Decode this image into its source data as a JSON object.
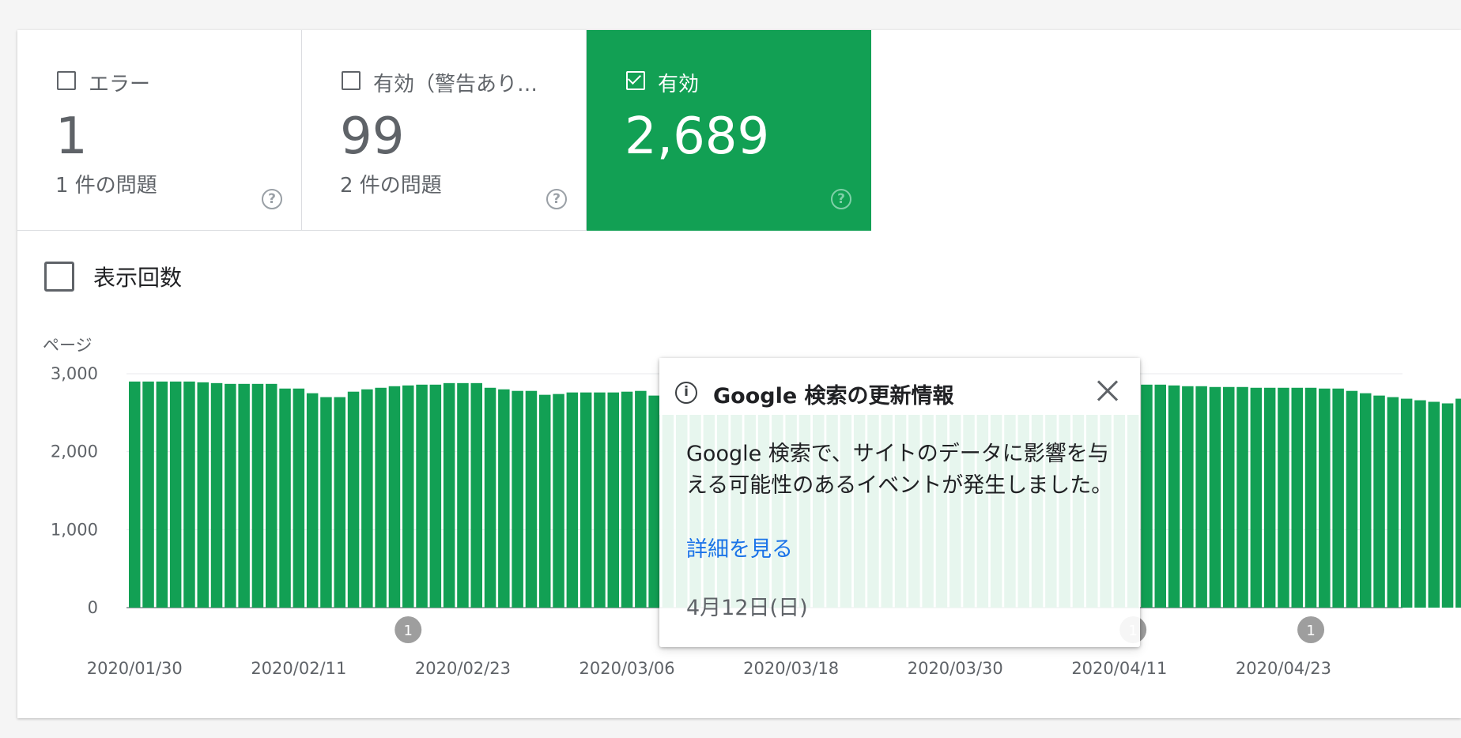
{
  "tiles": [
    {
      "label": "エラー",
      "value": "1",
      "sub": "1 件の問題",
      "checked": false,
      "help": "?"
    },
    {
      "label": "有効（警告あり…",
      "value": "99",
      "sub": "2 件の問題",
      "checked": false,
      "help": "?"
    },
    {
      "label": "有効",
      "value": "2,689",
      "sub": "",
      "checked": true,
      "help": "?"
    }
  ],
  "impressions_toggle": {
    "label": "表示回数"
  },
  "colors": {
    "accent": "#12a054",
    "grid": "#e8eaed",
    "axis_text": "#5f6368",
    "marker": "#9e9e9e",
    "highlight": "#e6f4ec"
  },
  "chart_data": {
    "type": "bar",
    "ylabel": "ページ",
    "ylim": [
      0,
      3000
    ],
    "yticks": [
      {
        "v": 0,
        "label": "0"
      },
      {
        "v": 1000,
        "label": "1,000"
      },
      {
        "v": 2000,
        "label": "2,000"
      },
      {
        "v": 3000,
        "label": "3,000"
      }
    ],
    "xtick_labels": [
      {
        "x": "2020-01-30",
        "label": "2020/01/30"
      },
      {
        "x": "2020-02-11",
        "label": "2020/02/11"
      },
      {
        "x": "2020-02-23",
        "label": "2020/02/23"
      },
      {
        "x": "2020-03-06",
        "label": "2020/03/06"
      },
      {
        "x": "2020-03-18",
        "label": "2020/03/18"
      },
      {
        "x": "2020-03-30",
        "label": "2020/03/30"
      },
      {
        "x": "2020-04-11",
        "label": "2020/04/11"
      },
      {
        "x": "2020-04-23",
        "label": "2020/04/23"
      }
    ],
    "series": [
      {
        "values": [
          2900,
          2900,
          2900,
          2900,
          2900,
          2890,
          2880,
          2870,
          2870,
          2870,
          2870,
          2810,
          2810,
          2750,
          2700,
          2700,
          2770,
          2800,
          2820,
          2840,
          2850,
          2860,
          2860,
          2880,
          2880,
          2880,
          2820,
          2800,
          2780,
          2780,
          2730,
          2740,
          2760,
          2760,
          2760,
          2760,
          2770,
          2780,
          2720,
          2720,
          2720,
          2720,
          2720,
          2730,
          2730,
          2730,
          2730,
          2730,
          2740,
          2740,
          2750,
          2760,
          2770,
          2780,
          2780,
          2790,
          2790,
          2790,
          2790,
          2800,
          2810,
          2810,
          2810,
          2810,
          2810,
          2820,
          2820,
          2820,
          2820,
          2840,
          2850,
          2850,
          2860,
          2860,
          2860,
          2860,
          2850,
          2840,
          2840,
          2830,
          2830,
          2830,
          2820,
          2820,
          2820,
          2820,
          2820,
          2810,
          2810,
          2780,
          2750,
          2720,
          2700,
          2680,
          2660,
          2640,
          2620,
          2680
        ]
      }
    ],
    "highlight_range": [
      "2020-03-10",
      "2020-04-12"
    ],
    "markers": [
      {
        "x": "2020-02-19",
        "label": "1"
      },
      {
        "x": "2020-04-12",
        "label": "1"
      },
      {
        "x": "2020-04-25",
        "label": "1"
      }
    ]
  },
  "popup": {
    "info_icon": "i",
    "title": "Google 検索の更新情報",
    "body": "Google 検索で、サイトのデータに影響を与える可能性のあるイベントが発生しました。",
    "link": "詳細を見る",
    "date": "4月12日(日)"
  }
}
